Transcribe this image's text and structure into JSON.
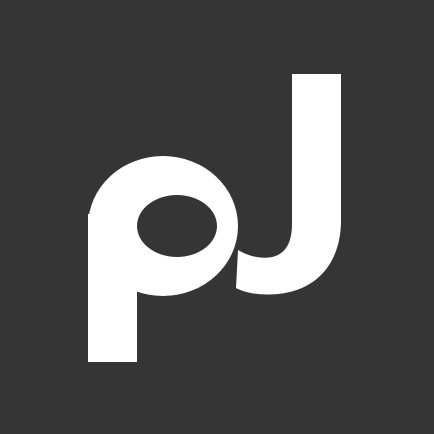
{
  "logo": {
    "icon_name": "pj-monogram-icon",
    "background_color": "#353535",
    "mark_color": "#ffffff"
  }
}
